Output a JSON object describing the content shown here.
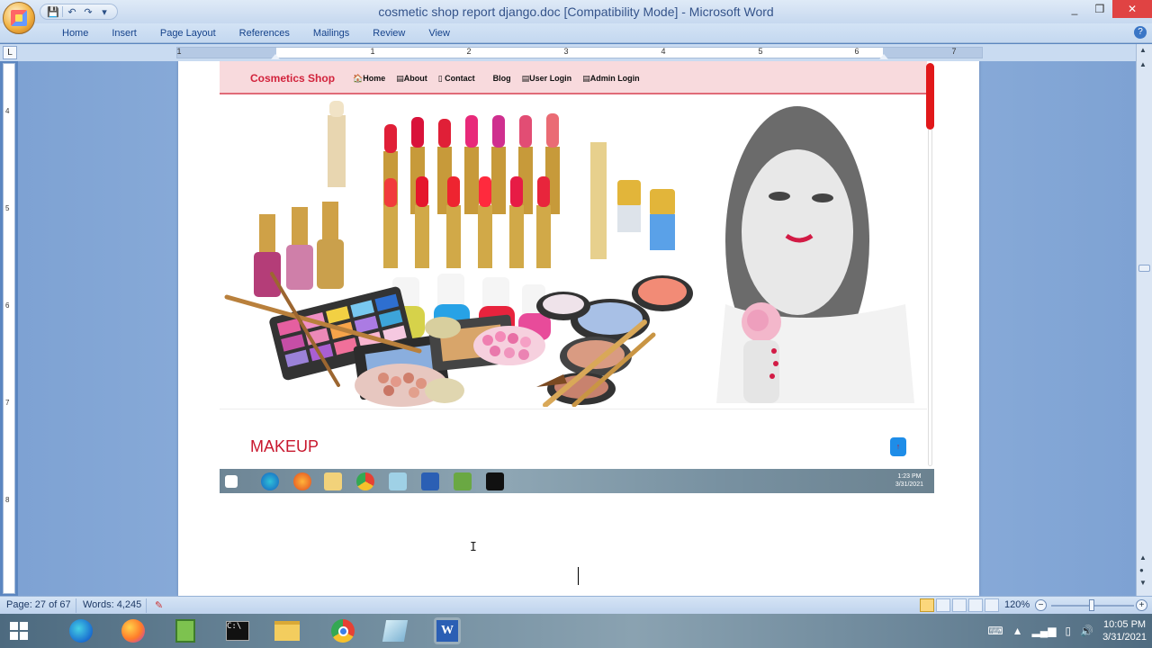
{
  "window": {
    "title": "cosmetic shop report django.doc [Compatibility Mode] - Microsoft Word",
    "controls": [
      "_",
      "❒",
      "✕"
    ]
  },
  "quick_access": {
    "save": "💾",
    "undo": "↶",
    "redo": "↷",
    "more": "▾"
  },
  "ribbon_tabs": [
    "Home",
    "Insert",
    "Page Layout",
    "References",
    "Mailings",
    "Review",
    "View"
  ],
  "ruler": {
    "tab_selector": "L",
    "numbers": [
      "1",
      "1",
      "2",
      "3",
      "4",
      "5",
      "6",
      "7"
    ]
  },
  "vruler_numbers": [
    "4",
    "5",
    "6",
    "7",
    "8"
  ],
  "embedded_site": {
    "brand": "Cosmetics Shop",
    "nav": [
      "🏠Home",
      "▤About",
      "▯ Contact",
      "Blog",
      "▤User Login",
      "▤Admin Login"
    ],
    "section_heading": "MAKEUP",
    "up_button": "↑",
    "inner_clock_time": "1:23 PM",
    "inner_clock_date": "3/31/2021"
  },
  "status_bar": {
    "page": "Page: 27 of 67",
    "words": "Words: 4,245",
    "zoom": "120%",
    "zoom_level": 0.5
  },
  "taskbar": {
    "clock_time": "10:05 PM",
    "clock_date": "3/31/2021"
  },
  "colors": {
    "brand_red": "#d2233c",
    "nav_bg": "#f8dadd",
    "word_blue": "#15428b"
  }
}
